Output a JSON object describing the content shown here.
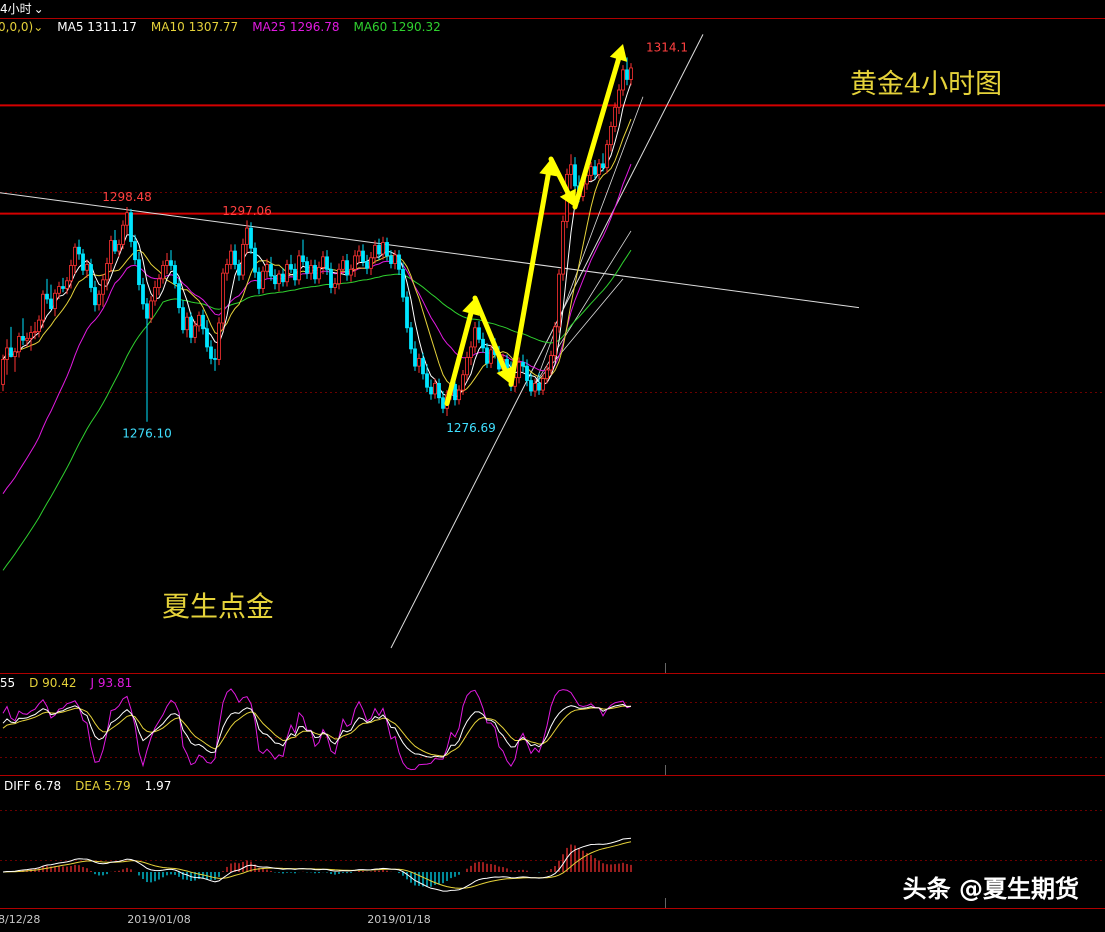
{
  "timeframe_label": "4小时",
  "main_params_partial": "0,0,0)",
  "ma_values": [
    {
      "label": "MA5",
      "value": "1311.17",
      "color": "#ffffff"
    },
    {
      "label": "MA10",
      "value": "1307.77",
      "color": "#e5d23a"
    },
    {
      "label": "MA25",
      "value": "1296.78",
      "color": "#e11ae0"
    },
    {
      "label": "MA60",
      "value": "1290.32",
      "color": "#2fd12f"
    }
  ],
  "kdj_values": [
    {
      "label": "",
      "value": ".55",
      "color": "#ffffff"
    },
    {
      "label": "D",
      "value": "90.42",
      "color": "#e5d23a"
    },
    {
      "label": "J",
      "value": "93.81",
      "color": "#e11ae0"
    }
  ],
  "macd_values": [
    {
      "label": "DIFF",
      "value": "6.78",
      "color": "#ffffff"
    },
    {
      "label": "DEA",
      "value": "5.79",
      "color": "#e5d23a"
    },
    {
      "label": "",
      "value": "1.97",
      "color": "#ffffff"
    }
  ],
  "chart_title": "黄金4小时图",
  "author_text": "夏生点金",
  "watermark": "头条 @夏生期货",
  "colors": {
    "up": "#ff3333",
    "down": "#00e5ff",
    "ma5": "#ffffff",
    "ma10": "#e5d23a",
    "ma25": "#e11ae0",
    "ma60": "#2fd12f",
    "arrow": "#ffff00",
    "hline": "#cc0000",
    "text_yellow": "#e5d23a"
  },
  "chart_data": {
    "type": "candlestick",
    "ylim": [
      1250,
      1318
    ],
    "annotations": [
      {
        "text": "1298.48",
        "value": 1298.48,
        "bar": 31,
        "kind": "high"
      },
      {
        "text": "1297.06",
        "value": 1297.06,
        "bar": 61,
        "kind": "high"
      },
      {
        "text": "1276.10",
        "value": 1276.1,
        "bar": 36,
        "kind": "low"
      },
      {
        "text": "1276.69",
        "value": 1276.69,
        "bar": 117,
        "kind": "low"
      },
      {
        "text": "1314.1",
        "value": 1314.1,
        "bar": 166,
        "kind": "high"
      }
    ],
    "horizontal_lines": [
      1309.1,
      1297.8
    ],
    "x_tick_labels": [
      {
        "text": "8/12/28",
        "bar": 0
      },
      {
        "text": "2019/01/08",
        "bar": 39
      },
      {
        "text": "2019/01/18",
        "bar": 99
      }
    ],
    "candles": [
      [
        1280.0,
        1283.1,
        1279.3,
        1282.6
      ],
      [
        1282.6,
        1284.7,
        1281.0,
        1283.8
      ],
      [
        1283.8,
        1286.0,
        1282.8,
        1282.9
      ],
      [
        1282.9,
        1283.8,
        1281.3,
        1283.4
      ],
      [
        1283.4,
        1285.4,
        1282.8,
        1285.0
      ],
      [
        1285.0,
        1286.9,
        1284.1,
        1284.6
      ],
      [
        1284.6,
        1285.4,
        1283.9,
        1284.8
      ],
      [
        1284.8,
        1286.1,
        1283.5,
        1285.4
      ],
      [
        1285.4,
        1286.5,
        1284.7,
        1285.5
      ],
      [
        1285.5,
        1287.2,
        1284.9,
        1286.7
      ],
      [
        1286.7,
        1289.8,
        1285.9,
        1289.4
      ],
      [
        1289.4,
        1291.0,
        1288.4,
        1288.9
      ],
      [
        1288.9,
        1290.4,
        1287.8,
        1287.9
      ],
      [
        1287.9,
        1289.9,
        1287.1,
        1289.5
      ],
      [
        1289.5,
        1290.7,
        1288.9,
        1290.2
      ],
      [
        1290.2,
        1291.1,
        1289.6,
        1290.0
      ],
      [
        1290.0,
        1291.2,
        1289.4,
        1290.8
      ],
      [
        1290.8,
        1293.0,
        1290.0,
        1292.4
      ],
      [
        1292.4,
        1294.7,
        1291.5,
        1294.3
      ],
      [
        1294.3,
        1295.1,
        1293.0,
        1293.6
      ],
      [
        1293.6,
        1294.1,
        1291.4,
        1291.9
      ],
      [
        1291.9,
        1293.0,
        1291.1,
        1292.5
      ],
      [
        1292.5,
        1293.1,
        1289.6,
        1290.1
      ],
      [
        1290.1,
        1290.8,
        1287.6,
        1288.3
      ],
      [
        1288.3,
        1289.8,
        1287.7,
        1289.4
      ],
      [
        1289.4,
        1291.5,
        1288.1,
        1290.9
      ],
      [
        1290.9,
        1293.2,
        1289.8,
        1292.6
      ],
      [
        1292.6,
        1295.5,
        1291.7,
        1295.0
      ],
      [
        1295.0,
        1296.1,
        1293.6,
        1293.9
      ],
      [
        1293.9,
        1295.1,
        1293.3,
        1294.6
      ],
      [
        1294.6,
        1297.1,
        1294.1,
        1296.6
      ],
      [
        1296.6,
        1298.5,
        1295.6,
        1297.9
      ],
      [
        1297.9,
        1298.3,
        1294.3,
        1294.9
      ],
      [
        1294.9,
        1295.6,
        1292.5,
        1293.0
      ],
      [
        1293.0,
        1293.8,
        1289.8,
        1290.4
      ],
      [
        1290.4,
        1291.1,
        1287.8,
        1288.4
      ],
      [
        1288.4,
        1289.0,
        1276.1,
        1286.9
      ],
      [
        1286.9,
        1289.2,
        1286.4,
        1288.7
      ],
      [
        1288.7,
        1290.8,
        1288.2,
        1290.1
      ],
      [
        1290.1,
        1291.5,
        1289.3,
        1291.0
      ],
      [
        1291.0,
        1292.9,
        1290.5,
        1292.4
      ],
      [
        1292.4,
        1293.7,
        1291.5,
        1292.9
      ],
      [
        1292.9,
        1294.0,
        1291.9,
        1292.4
      ],
      [
        1292.4,
        1292.9,
        1290.0,
        1290.5
      ],
      [
        1290.5,
        1291.0,
        1287.4,
        1288.0
      ],
      [
        1288.0,
        1288.8,
        1285.3,
        1285.7
      ],
      [
        1285.7,
        1287.5,
        1284.9,
        1287.0
      ],
      [
        1287.0,
        1287.5,
        1284.3,
        1284.9
      ],
      [
        1284.9,
        1286.6,
        1284.3,
        1286.1
      ],
      [
        1286.1,
        1287.6,
        1285.5,
        1287.2
      ],
      [
        1287.2,
        1287.8,
        1285.2,
        1285.8
      ],
      [
        1285.8,
        1286.7,
        1283.4,
        1283.9
      ],
      [
        1283.9,
        1284.6,
        1282.1,
        1282.7
      ],
      [
        1282.7,
        1283.7,
        1281.4,
        1282.6
      ],
      [
        1282.6,
        1287.0,
        1282.0,
        1286.4
      ],
      [
        1286.4,
        1292.1,
        1285.6,
        1291.6
      ],
      [
        1291.6,
        1293.1,
        1290.8,
        1292.5
      ],
      [
        1292.5,
        1294.6,
        1292.0,
        1293.9
      ],
      [
        1293.9,
        1294.6,
        1292.0,
        1292.5
      ],
      [
        1292.5,
        1293.0,
        1290.8,
        1291.4
      ],
      [
        1291.4,
        1295.2,
        1290.9,
        1294.6
      ],
      [
        1294.6,
        1297.1,
        1293.6,
        1296.3
      ],
      [
        1296.3,
        1296.9,
        1293.6,
        1294.2
      ],
      [
        1294.2,
        1294.8,
        1291.1,
        1291.7
      ],
      [
        1291.7,
        1292.2,
        1289.4,
        1290.0
      ],
      [
        1290.0,
        1292.3,
        1289.5,
        1291.8
      ],
      [
        1291.8,
        1293.1,
        1291.1,
        1292.5
      ],
      [
        1292.5,
        1293.3,
        1290.8,
        1291.3
      ],
      [
        1291.3,
        1292.0,
        1289.9,
        1290.5
      ],
      [
        1290.5,
        1291.9,
        1289.7,
        1291.5
      ],
      [
        1291.5,
        1292.1,
        1290.2,
        1290.7
      ],
      [
        1290.7,
        1293.0,
        1290.2,
        1292.5
      ],
      [
        1292.5,
        1293.5,
        1291.6,
        1292.0
      ],
      [
        1292.0,
        1292.6,
        1290.3,
        1290.9
      ],
      [
        1290.9,
        1294.0,
        1290.4,
        1293.4
      ],
      [
        1293.4,
        1295.1,
        1292.4,
        1292.8
      ],
      [
        1292.8,
        1293.3,
        1291.0,
        1291.6
      ],
      [
        1291.6,
        1293.0,
        1290.9,
        1292.4
      ],
      [
        1292.4,
        1293.0,
        1290.5,
        1291.0
      ],
      [
        1291.0,
        1292.8,
        1290.5,
        1292.2
      ],
      [
        1292.2,
        1293.9,
        1291.5,
        1293.3
      ],
      [
        1293.3,
        1294.0,
        1291.4,
        1292.0
      ],
      [
        1292.0,
        1292.7,
        1289.5,
        1290.1
      ],
      [
        1290.1,
        1291.1,
        1289.4,
        1290.5
      ],
      [
        1290.5,
        1292.6,
        1289.9,
        1292.0
      ],
      [
        1292.0,
        1293.4,
        1291.5,
        1292.9
      ],
      [
        1292.9,
        1293.6,
        1290.8,
        1291.4
      ],
      [
        1291.4,
        1292.5,
        1290.7,
        1292.0
      ],
      [
        1292.0,
        1294.0,
        1291.2,
        1293.4
      ],
      [
        1293.4,
        1294.5,
        1292.6,
        1293.9
      ],
      [
        1293.9,
        1294.6,
        1292.3,
        1292.8
      ],
      [
        1292.8,
        1293.5,
        1291.5,
        1292.1
      ],
      [
        1292.1,
        1293.8,
        1291.4,
        1293.2
      ],
      [
        1293.2,
        1295.0,
        1292.6,
        1294.5
      ],
      [
        1294.5,
        1295.2,
        1293.0,
        1293.6
      ],
      [
        1293.6,
        1295.4,
        1293.0,
        1294.8
      ],
      [
        1294.8,
        1295.3,
        1292.9,
        1293.4
      ],
      [
        1293.4,
        1294.0,
        1292.1,
        1292.6
      ],
      [
        1292.6,
        1294.0,
        1292.0,
        1293.5
      ],
      [
        1293.5,
        1294.0,
        1291.4,
        1292.0
      ],
      [
        1292.0,
        1292.7,
        1288.6,
        1289.1
      ],
      [
        1289.1,
        1289.7,
        1285.4,
        1285.9
      ],
      [
        1285.9,
        1286.5,
        1283.2,
        1283.7
      ],
      [
        1283.7,
        1284.5,
        1281.4,
        1281.9
      ],
      [
        1281.9,
        1283.2,
        1281.2,
        1282.7
      ],
      [
        1282.7,
        1283.3,
        1280.5,
        1281.1
      ],
      [
        1281.1,
        1282.1,
        1279.2,
        1279.7
      ],
      [
        1279.7,
        1280.5,
        1278.4,
        1279.0
      ],
      [
        1279.0,
        1280.6,
        1278.5,
        1280.1
      ],
      [
        1280.1,
        1280.6,
        1278.0,
        1278.6
      ],
      [
        1278.6,
        1279.3,
        1277.0,
        1277.5
      ],
      [
        1277.5,
        1279.4,
        1276.7,
        1278.9
      ],
      [
        1278.9,
        1280.5,
        1278.4,
        1280.0
      ],
      [
        1280.0,
        1280.7,
        1277.8,
        1278.4
      ],
      [
        1278.4,
        1279.9,
        1277.9,
        1279.4
      ],
      [
        1279.4,
        1281.5,
        1278.9,
        1281.0
      ],
      [
        1281.0,
        1283.4,
        1280.4,
        1282.8
      ],
      [
        1282.8,
        1284.5,
        1282.0,
        1283.9
      ],
      [
        1283.9,
        1286.5,
        1283.3,
        1285.9
      ],
      [
        1285.9,
        1286.6,
        1284.3,
        1284.7
      ],
      [
        1284.7,
        1285.4,
        1283.3,
        1283.8
      ],
      [
        1283.8,
        1284.3,
        1281.7,
        1282.2
      ],
      [
        1282.2,
        1284.1,
        1281.7,
        1283.6
      ],
      [
        1283.6,
        1284.8,
        1282.7,
        1283.1
      ],
      [
        1283.1,
        1284.0,
        1281.1,
        1281.6
      ],
      [
        1281.6,
        1283.2,
        1281.0,
        1282.6
      ],
      [
        1282.6,
        1283.1,
        1280.7,
        1281.3
      ],
      [
        1281.3,
        1282.4,
        1279.3,
        1279.8
      ],
      [
        1279.8,
        1281.3,
        1279.2,
        1280.7
      ],
      [
        1280.7,
        1282.8,
        1280.1,
        1282.3
      ],
      [
        1282.3,
        1283.1,
        1281.3,
        1281.9
      ],
      [
        1281.9,
        1282.6,
        1279.8,
        1280.4
      ],
      [
        1280.4,
        1281.1,
        1278.8,
        1279.3
      ],
      [
        1279.3,
        1280.6,
        1278.7,
        1280.1
      ],
      [
        1280.1,
        1281.2,
        1278.9,
        1279.4
      ],
      [
        1279.4,
        1281.1,
        1278.9,
        1280.6
      ],
      [
        1280.6,
        1282.0,
        1280.1,
        1281.5
      ],
      [
        1281.5,
        1283.5,
        1281.0,
        1283.0
      ],
      [
        1283.0,
        1286.5,
        1282.4,
        1286.0
      ],
      [
        1286.0,
        1292.0,
        1285.4,
        1291.5
      ],
      [
        1291.5,
        1297.6,
        1290.8,
        1297.0
      ],
      [
        1297.0,
        1302.5,
        1296.3,
        1301.9
      ],
      [
        1301.9,
        1304.0,
        1300.4,
        1302.9
      ],
      [
        1302.9,
        1303.7,
        1300.1,
        1300.7
      ],
      [
        1300.7,
        1301.8,
        1299.0,
        1299.6
      ],
      [
        1299.6,
        1301.4,
        1299.1,
        1300.9
      ],
      [
        1300.9,
        1302.4,
        1300.3,
        1301.8
      ],
      [
        1301.8,
        1303.2,
        1301.2,
        1302.7
      ],
      [
        1302.7,
        1303.4,
        1301.4,
        1301.9
      ],
      [
        1301.9,
        1303.5,
        1301.4,
        1303.0
      ],
      [
        1303.0,
        1304.1,
        1302.2,
        1302.6
      ],
      [
        1302.6,
        1305.5,
        1302.0,
        1305.0
      ],
      [
        1305.0,
        1307.4,
        1304.3,
        1306.9
      ],
      [
        1306.9,
        1309.4,
        1306.3,
        1308.9
      ],
      [
        1308.9,
        1311.3,
        1308.2,
        1310.7
      ],
      [
        1310.7,
        1313.3,
        1310.1,
        1312.8
      ],
      [
        1312.8,
        1314.1,
        1311.2,
        1311.8
      ],
      [
        1311.8,
        1313.5,
        1311.2,
        1313.0
      ]
    ],
    "arrows": [
      {
        "from": [
          111,
          1278
        ],
        "to": [
          118,
          1289
        ]
      },
      {
        "from": [
          118,
          1289
        ],
        "to": [
          127,
          1280
        ]
      },
      {
        "from": [
          127,
          1280
        ],
        "to": [
          137,
          1303.5
        ]
      },
      {
        "from": [
          137,
          1303.5
        ],
        "to": [
          143,
          1298.5
        ]
      },
      {
        "from": [
          143,
          1298.5
        ],
        "to": [
          155,
          1315.5
        ]
      }
    ],
    "trend_lines": [
      {
        "from": [
          -1,
          1300.0
        ],
        "to": [
          214,
          1288.0
        ]
      },
      {
        "from": [
          97,
          1252.5
        ],
        "to": [
          175,
          1316.5
        ]
      }
    ],
    "fan_lines": [
      {
        "from": [
          133,
          1280
        ],
        "to": [
          160,
          1310
        ]
      },
      {
        "from": [
          133,
          1280
        ],
        "to": [
          157,
          1296
        ]
      },
      {
        "from": [
          133,
          1280
        ],
        "to": [
          155,
          1291
        ]
      }
    ]
  }
}
